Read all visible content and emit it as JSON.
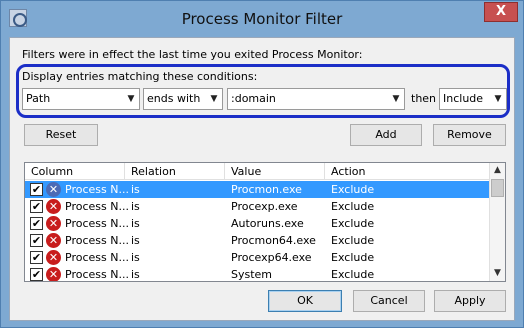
{
  "window": {
    "title": "Process Monitor Filter",
    "close_label": "X"
  },
  "info_text": "Filters were in effect the last time you exited Process Monitor:",
  "condition": {
    "label": "Display entries matching these conditions:",
    "column_value": "Path",
    "relation_value": "ends with",
    "value_value": ":domain",
    "then_label": "then",
    "action_value": "Include"
  },
  "buttons": {
    "reset": "Reset",
    "add": "Add",
    "remove": "Remove",
    "ok": "OK",
    "cancel": "Cancel",
    "apply": "Apply"
  },
  "list": {
    "headers": [
      "Column",
      "Relation",
      "Value",
      "Action"
    ],
    "rows": [
      {
        "column": "Process N...",
        "relation": "is",
        "value": "Procmon.exe",
        "action": "Exclude",
        "checked": "✔",
        "icon": "exclude-icon-blue"
      },
      {
        "column": "Process N...",
        "relation": "is",
        "value": "Procexp.exe",
        "action": "Exclude",
        "checked": "✔",
        "icon": "exclude-icon"
      },
      {
        "column": "Process N...",
        "relation": "is",
        "value": "Autoruns.exe",
        "action": "Exclude",
        "checked": "✔",
        "icon": "exclude-icon"
      },
      {
        "column": "Process N...",
        "relation": "is",
        "value": "Procmon64.exe",
        "action": "Exclude",
        "checked": "✔",
        "icon": "exclude-icon"
      },
      {
        "column": "Process N...",
        "relation": "is",
        "value": "Procexp64.exe",
        "action": "Exclude",
        "checked": "✔",
        "icon": "exclude-icon"
      },
      {
        "column": "Process N...",
        "relation": "is",
        "value": "System",
        "action": "Exclude",
        "checked": "✔",
        "icon": "exclude-icon"
      }
    ]
  },
  "colors": {
    "selection": "#3399ff",
    "highlight_border": "#1b2ec7",
    "exclude_icon": "#c81d1d"
  }
}
